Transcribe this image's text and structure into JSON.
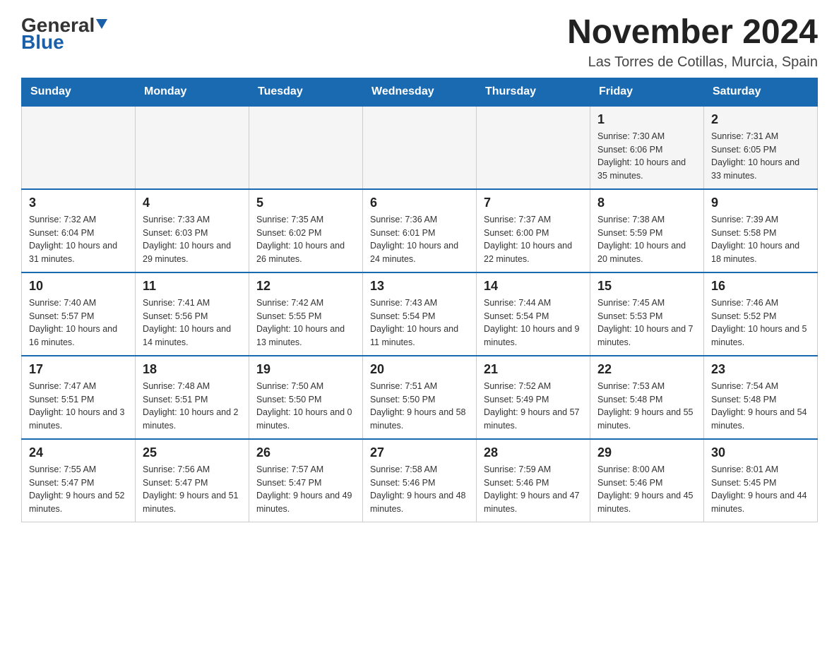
{
  "logo": {
    "general": "General",
    "blue": "Blue"
  },
  "title": "November 2024",
  "subtitle": "Las Torres de Cotillas, Murcia, Spain",
  "days_of_week": [
    "Sunday",
    "Monday",
    "Tuesday",
    "Wednesday",
    "Thursday",
    "Friday",
    "Saturday"
  ],
  "weeks": [
    [
      {
        "day": "",
        "info": ""
      },
      {
        "day": "",
        "info": ""
      },
      {
        "day": "",
        "info": ""
      },
      {
        "day": "",
        "info": ""
      },
      {
        "day": "",
        "info": ""
      },
      {
        "day": "1",
        "info": "Sunrise: 7:30 AM\nSunset: 6:06 PM\nDaylight: 10 hours and 35 minutes."
      },
      {
        "day": "2",
        "info": "Sunrise: 7:31 AM\nSunset: 6:05 PM\nDaylight: 10 hours and 33 minutes."
      }
    ],
    [
      {
        "day": "3",
        "info": "Sunrise: 7:32 AM\nSunset: 6:04 PM\nDaylight: 10 hours and 31 minutes."
      },
      {
        "day": "4",
        "info": "Sunrise: 7:33 AM\nSunset: 6:03 PM\nDaylight: 10 hours and 29 minutes."
      },
      {
        "day": "5",
        "info": "Sunrise: 7:35 AM\nSunset: 6:02 PM\nDaylight: 10 hours and 26 minutes."
      },
      {
        "day": "6",
        "info": "Sunrise: 7:36 AM\nSunset: 6:01 PM\nDaylight: 10 hours and 24 minutes."
      },
      {
        "day": "7",
        "info": "Sunrise: 7:37 AM\nSunset: 6:00 PM\nDaylight: 10 hours and 22 minutes."
      },
      {
        "day": "8",
        "info": "Sunrise: 7:38 AM\nSunset: 5:59 PM\nDaylight: 10 hours and 20 minutes."
      },
      {
        "day": "9",
        "info": "Sunrise: 7:39 AM\nSunset: 5:58 PM\nDaylight: 10 hours and 18 minutes."
      }
    ],
    [
      {
        "day": "10",
        "info": "Sunrise: 7:40 AM\nSunset: 5:57 PM\nDaylight: 10 hours and 16 minutes."
      },
      {
        "day": "11",
        "info": "Sunrise: 7:41 AM\nSunset: 5:56 PM\nDaylight: 10 hours and 14 minutes."
      },
      {
        "day": "12",
        "info": "Sunrise: 7:42 AM\nSunset: 5:55 PM\nDaylight: 10 hours and 13 minutes."
      },
      {
        "day": "13",
        "info": "Sunrise: 7:43 AM\nSunset: 5:54 PM\nDaylight: 10 hours and 11 minutes."
      },
      {
        "day": "14",
        "info": "Sunrise: 7:44 AM\nSunset: 5:54 PM\nDaylight: 10 hours and 9 minutes."
      },
      {
        "day": "15",
        "info": "Sunrise: 7:45 AM\nSunset: 5:53 PM\nDaylight: 10 hours and 7 minutes."
      },
      {
        "day": "16",
        "info": "Sunrise: 7:46 AM\nSunset: 5:52 PM\nDaylight: 10 hours and 5 minutes."
      }
    ],
    [
      {
        "day": "17",
        "info": "Sunrise: 7:47 AM\nSunset: 5:51 PM\nDaylight: 10 hours and 3 minutes."
      },
      {
        "day": "18",
        "info": "Sunrise: 7:48 AM\nSunset: 5:51 PM\nDaylight: 10 hours and 2 minutes."
      },
      {
        "day": "19",
        "info": "Sunrise: 7:50 AM\nSunset: 5:50 PM\nDaylight: 10 hours and 0 minutes."
      },
      {
        "day": "20",
        "info": "Sunrise: 7:51 AM\nSunset: 5:50 PM\nDaylight: 9 hours and 58 minutes."
      },
      {
        "day": "21",
        "info": "Sunrise: 7:52 AM\nSunset: 5:49 PM\nDaylight: 9 hours and 57 minutes."
      },
      {
        "day": "22",
        "info": "Sunrise: 7:53 AM\nSunset: 5:48 PM\nDaylight: 9 hours and 55 minutes."
      },
      {
        "day": "23",
        "info": "Sunrise: 7:54 AM\nSunset: 5:48 PM\nDaylight: 9 hours and 54 minutes."
      }
    ],
    [
      {
        "day": "24",
        "info": "Sunrise: 7:55 AM\nSunset: 5:47 PM\nDaylight: 9 hours and 52 minutes."
      },
      {
        "day": "25",
        "info": "Sunrise: 7:56 AM\nSunset: 5:47 PM\nDaylight: 9 hours and 51 minutes."
      },
      {
        "day": "26",
        "info": "Sunrise: 7:57 AM\nSunset: 5:47 PM\nDaylight: 9 hours and 49 minutes."
      },
      {
        "day": "27",
        "info": "Sunrise: 7:58 AM\nSunset: 5:46 PM\nDaylight: 9 hours and 48 minutes."
      },
      {
        "day": "28",
        "info": "Sunrise: 7:59 AM\nSunset: 5:46 PM\nDaylight: 9 hours and 47 minutes."
      },
      {
        "day": "29",
        "info": "Sunrise: 8:00 AM\nSunset: 5:46 PM\nDaylight: 9 hours and 45 minutes."
      },
      {
        "day": "30",
        "info": "Sunrise: 8:01 AM\nSunset: 5:45 PM\nDaylight: 9 hours and 44 minutes."
      }
    ]
  ]
}
